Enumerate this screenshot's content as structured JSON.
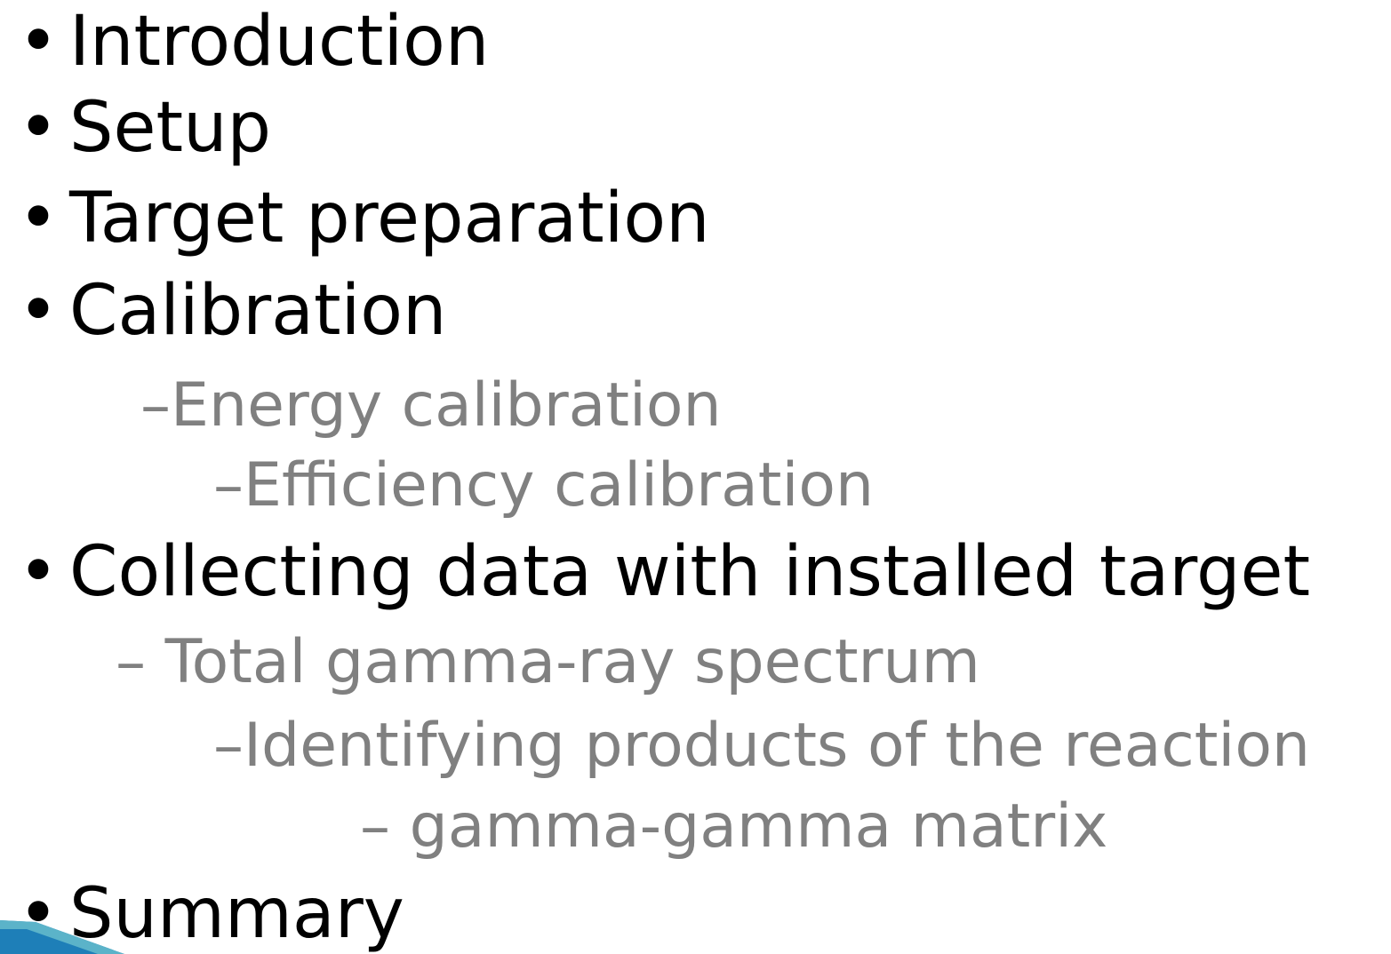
{
  "outline": {
    "bullet_symbol": "•",
    "items": [
      {
        "text": "Introduction",
        "level": 0
      },
      {
        "text": "Setup",
        "level": 0
      },
      {
        "text": "Target preparation",
        "level": 0
      },
      {
        "text": "Calibration",
        "level": 0
      },
      {
        "text": "–Energy calibration",
        "level": 1
      },
      {
        "text": "–Efficiency calibration",
        "level": 2
      },
      {
        "text": "Collecting data with installed target",
        "level": 0
      },
      {
        "text": "– Total gamma-ray spectrum",
        "level": 1
      },
      {
        "text": "–Identifying products of the reaction",
        "level": 2
      },
      {
        "text": "– gamma-gamma matrix",
        "level": 3
      },
      {
        "text": "Summary",
        "level": 0
      }
    ]
  },
  "colors": {
    "main_text": "#000000",
    "sub_text": "#808080",
    "decor_blue": "#1e7fb8",
    "decor_teal": "#5bb3c9"
  }
}
